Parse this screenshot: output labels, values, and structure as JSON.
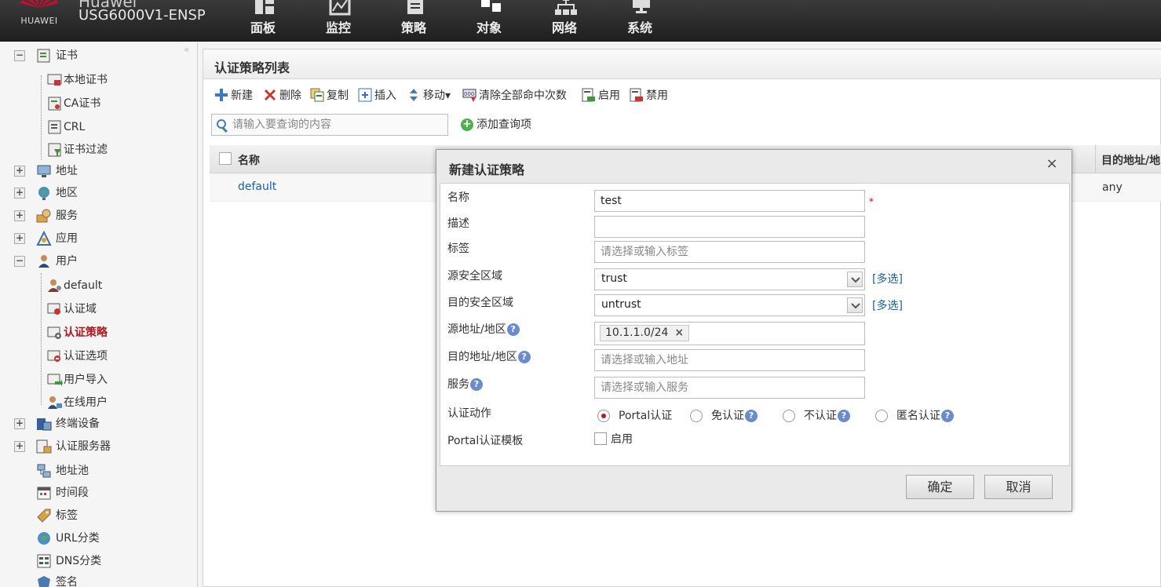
{
  "header": {
    "vendor": "Huawei",
    "brand": "HUAWEI",
    "title": "USG6000V1-ENSP",
    "nav": [
      {
        "label": "面板",
        "icon": "dashboard-icon"
      },
      {
        "label": "监控",
        "icon": "monitor-icon"
      },
      {
        "label": "策略",
        "icon": "policy-icon"
      },
      {
        "label": "对象",
        "icon": "object-icon"
      },
      {
        "label": "网络",
        "icon": "network-icon"
      },
      {
        "label": "系统",
        "icon": "system-icon"
      }
    ]
  },
  "sidebar": {
    "items": [
      {
        "label": "证书",
        "toggle": "−"
      },
      {
        "label": "本地证书"
      },
      {
        "label": "CA证书"
      },
      {
        "label": "CRL"
      },
      {
        "label": "证书过滤"
      },
      {
        "label": "地址",
        "toggle": "+"
      },
      {
        "label": "地区",
        "toggle": "+"
      },
      {
        "label": "服务",
        "toggle": "+"
      },
      {
        "label": "应用",
        "toggle": "+"
      },
      {
        "label": "用户",
        "toggle": "−"
      },
      {
        "label": "default"
      },
      {
        "label": "认证域"
      },
      {
        "label": "认证策略",
        "selected": true
      },
      {
        "label": "认证选项"
      },
      {
        "label": "用户导入"
      },
      {
        "label": "在线用户"
      },
      {
        "label": "终端设备",
        "toggle": "+"
      },
      {
        "label": "认证服务器",
        "toggle": "+"
      },
      {
        "label": "地址池"
      },
      {
        "label": "时间段"
      },
      {
        "label": "标签"
      },
      {
        "label": "URL分类"
      },
      {
        "label": "DNS分类"
      },
      {
        "label": "签名"
      }
    ]
  },
  "panel": {
    "title": "认证策略列表",
    "toolbar": [
      {
        "label": "新建",
        "icon": "add-icon"
      },
      {
        "label": "删除",
        "icon": "delete-icon"
      },
      {
        "label": "复制",
        "icon": "copy-icon"
      },
      {
        "label": "插入",
        "icon": "insert-icon"
      },
      {
        "label": "移动▾",
        "icon": "move-icon"
      },
      {
        "label": "清除全部命中次数",
        "icon": "clear-hits-icon"
      },
      {
        "label": "启用",
        "icon": "enable-icon"
      },
      {
        "label": "禁用",
        "icon": "disable-icon"
      }
    ],
    "search_placeholder": "请输入要查询的内容",
    "add_query": "添加查询项",
    "table": {
      "headers": [
        "名称",
        "目的地址/地"
      ],
      "rows": [
        {
          "name": "default",
          "dest": "any"
        }
      ]
    }
  },
  "dialog": {
    "title": "新建认证策略",
    "close": "×",
    "fields": {
      "name_label": "名称",
      "name_value": "test",
      "required_mark": "*",
      "desc_label": "描述",
      "tag_label": "标签",
      "tag_placeholder": "请选择或输入标签",
      "src_zone_label": "源安全区域",
      "src_zone_value": "trust",
      "dst_zone_label": "目的安全区域",
      "dst_zone_value": "untrust",
      "multi_select": "[多选]",
      "src_addr_label": "源地址/地区",
      "src_addr_chip": "10.1.1.0/24",
      "dst_addr_label": "目的地址/地区",
      "dst_addr_placeholder": "请选择或输入地址",
      "service_label": "服务",
      "service_placeholder": "请选择或输入服务",
      "action_label": "认证动作",
      "actions": [
        "Portal认证",
        "免认证",
        "不认证",
        "匿名认证"
      ],
      "selected_action": "Portal认证",
      "portal_template_label": "Portal认证模板",
      "portal_enable": "启用",
      "portal_enabled": false
    },
    "ok": "确定",
    "cancel": "取消"
  },
  "colors": {
    "selected_text": "#b0171f",
    "link": "#1a5fb4",
    "header_bg": "#2b2b2b"
  }
}
